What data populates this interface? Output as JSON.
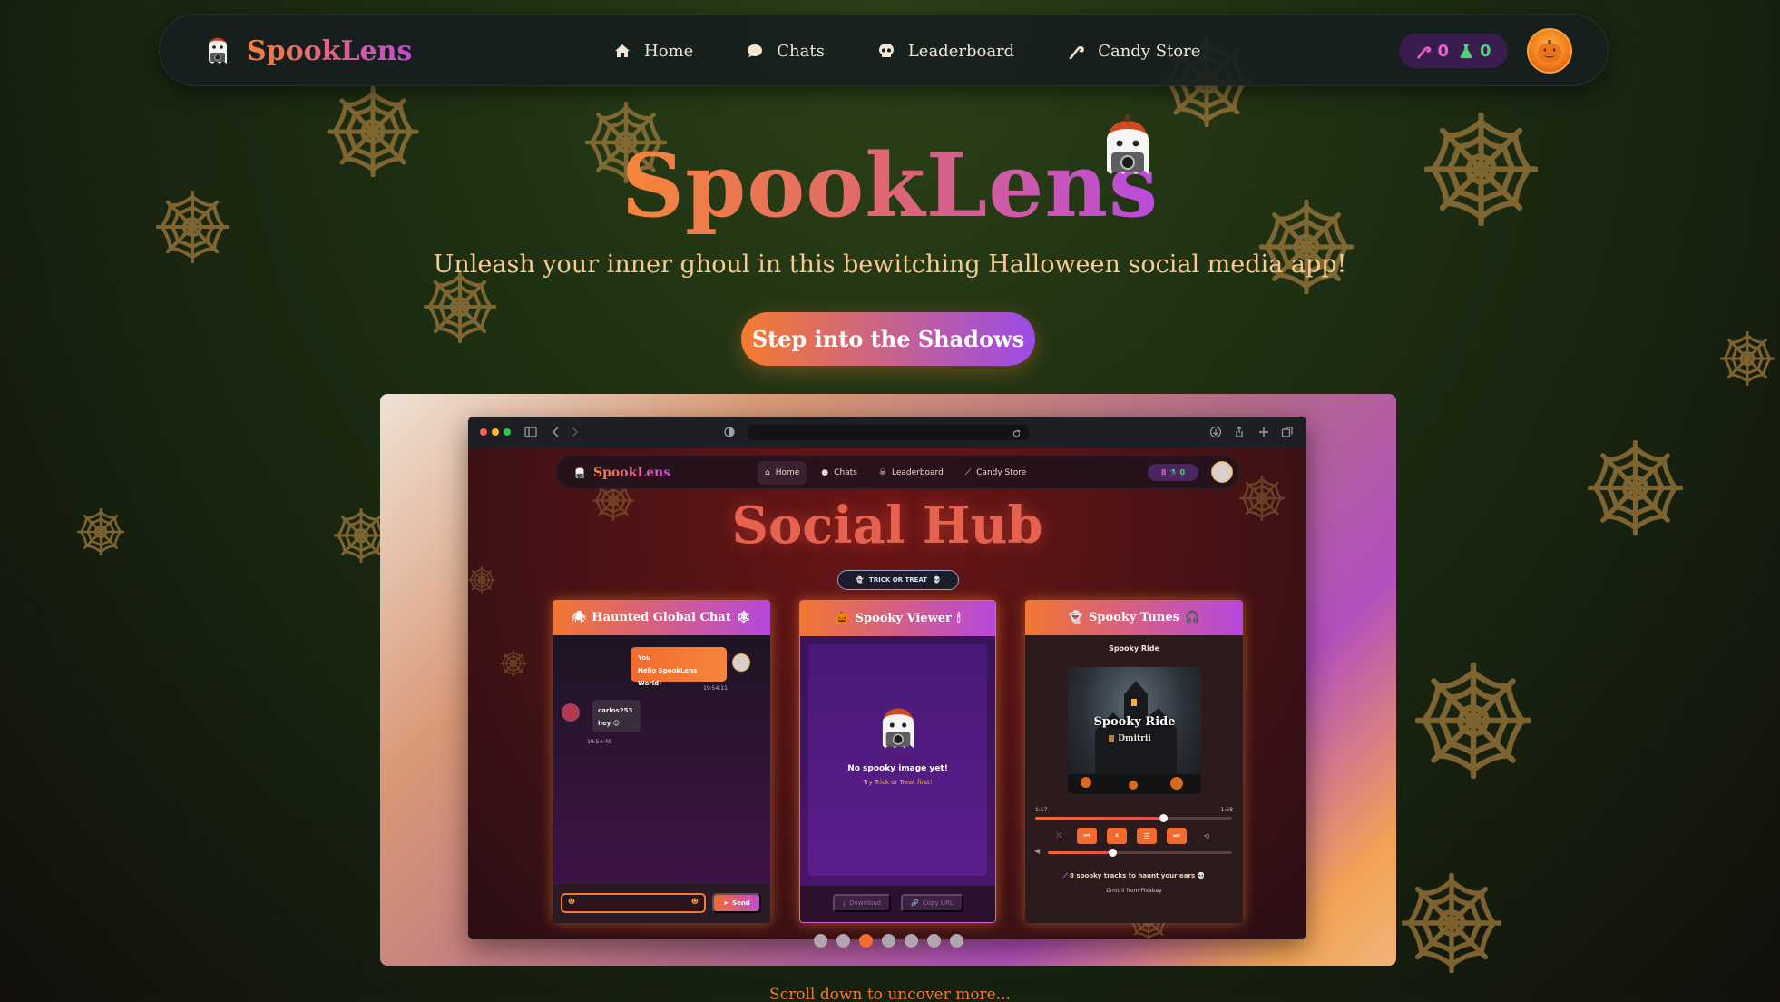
{
  "navbar": {
    "brand": "SpookLens",
    "links": [
      {
        "label": "Home",
        "icon": "home-icon"
      },
      {
        "label": "Chats",
        "icon": "chat-bubble-icon"
      },
      {
        "label": "Leaderboard",
        "icon": "skull-icon"
      },
      {
        "label": "Candy Store",
        "icon": "candy-cane-icon"
      }
    ],
    "candy_count": "0",
    "potion_count": "0"
  },
  "hero": {
    "title": "SpookLens",
    "tagline": "Unleash your inner ghoul in this bewitching Halloween social media app!",
    "cta_label": "Step into the Shadows"
  },
  "preview": {
    "mini_nav": {
      "brand": "SpookLens",
      "links": [
        {
          "label": "Home",
          "icon": "home-icon"
        },
        {
          "label": "Chats",
          "icon": "chat-bubble-icon"
        },
        {
          "label": "Leaderboard",
          "icon": "skull-icon"
        },
        {
          "label": "Candy Store",
          "icon": "candy-cane-icon"
        }
      ],
      "candy_count": "8",
      "potion_count": "0"
    },
    "title": "Social Hub",
    "trick_or_treat": "TRICK OR TREAT",
    "chat": {
      "title": "Haunted Global Chat",
      "me_name": "You",
      "me_text": "Hello SpookLens World!",
      "me_time": "19:54:11",
      "other_name": "carlos253",
      "other_text": "hey 😊",
      "other_time": "19:54:40",
      "send_label": "Send"
    },
    "viewer": {
      "title": "Spooky Viewer",
      "empty_title": "No spooky image yet!",
      "empty_sub": "Try Trick or Treat first!",
      "download_label": "Download",
      "copy_label": "Copy URL"
    },
    "tunes": {
      "title": "Spooky Tunes",
      "track": "Spooky Ride",
      "album_title": "Spooky Ride",
      "artist": "Dmitrii",
      "elapsed": "1:17",
      "duration": "1:58",
      "progress_fraction": 0.65,
      "volume_fraction": 0.35,
      "tracks_note": "8 spooky tracks to haunt your ears",
      "credit": "Dmitrii from Pixabay"
    },
    "carousel": {
      "count": 7,
      "active_index": 2
    }
  },
  "scroll_hint": "Scroll down to uncover more...",
  "colors": {
    "accent_orange": "#f57b2f",
    "accent_purple": "#9b4be8",
    "background": "#1d2e12",
    "web": "#a07a3c"
  }
}
